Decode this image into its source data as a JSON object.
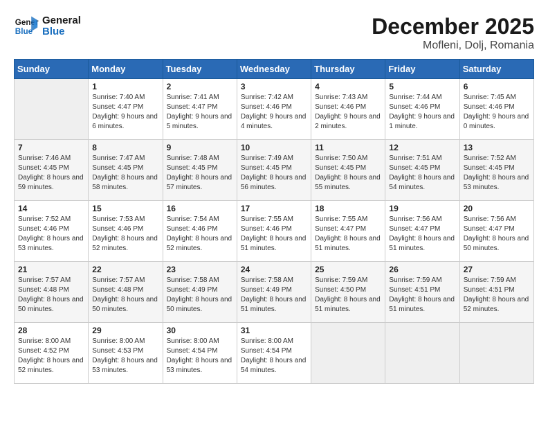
{
  "header": {
    "logo_line1": "General",
    "logo_line2": "Blue",
    "month": "December 2025",
    "location": "Mofleni, Dolj, Romania"
  },
  "weekdays": [
    "Sunday",
    "Monday",
    "Tuesday",
    "Wednesday",
    "Thursday",
    "Friday",
    "Saturday"
  ],
  "weeks": [
    [
      {
        "day": "",
        "empty": true
      },
      {
        "day": "1",
        "sunrise": "7:40 AM",
        "sunset": "4:47 PM",
        "daylight": "9 hours and 6 minutes."
      },
      {
        "day": "2",
        "sunrise": "7:41 AM",
        "sunset": "4:47 PM",
        "daylight": "9 hours and 5 minutes."
      },
      {
        "day": "3",
        "sunrise": "7:42 AM",
        "sunset": "4:46 PM",
        "daylight": "9 hours and 4 minutes."
      },
      {
        "day": "4",
        "sunrise": "7:43 AM",
        "sunset": "4:46 PM",
        "daylight": "9 hours and 2 minutes."
      },
      {
        "day": "5",
        "sunrise": "7:44 AM",
        "sunset": "4:46 PM",
        "daylight": "9 hours and 1 minute."
      },
      {
        "day": "6",
        "sunrise": "7:45 AM",
        "sunset": "4:46 PM",
        "daylight": "9 hours and 0 minutes."
      }
    ],
    [
      {
        "day": "7",
        "sunrise": "7:46 AM",
        "sunset": "4:45 PM",
        "daylight": "8 hours and 59 minutes."
      },
      {
        "day": "8",
        "sunrise": "7:47 AM",
        "sunset": "4:45 PM",
        "daylight": "8 hours and 58 minutes."
      },
      {
        "day": "9",
        "sunrise": "7:48 AM",
        "sunset": "4:45 PM",
        "daylight": "8 hours and 57 minutes."
      },
      {
        "day": "10",
        "sunrise": "7:49 AM",
        "sunset": "4:45 PM",
        "daylight": "8 hours and 56 minutes."
      },
      {
        "day": "11",
        "sunrise": "7:50 AM",
        "sunset": "4:45 PM",
        "daylight": "8 hours and 55 minutes."
      },
      {
        "day": "12",
        "sunrise": "7:51 AM",
        "sunset": "4:45 PM",
        "daylight": "8 hours and 54 minutes."
      },
      {
        "day": "13",
        "sunrise": "7:52 AM",
        "sunset": "4:45 PM",
        "daylight": "8 hours and 53 minutes."
      }
    ],
    [
      {
        "day": "14",
        "sunrise": "7:52 AM",
        "sunset": "4:46 PM",
        "daylight": "8 hours and 53 minutes."
      },
      {
        "day": "15",
        "sunrise": "7:53 AM",
        "sunset": "4:46 PM",
        "daylight": "8 hours and 52 minutes."
      },
      {
        "day": "16",
        "sunrise": "7:54 AM",
        "sunset": "4:46 PM",
        "daylight": "8 hours and 52 minutes."
      },
      {
        "day": "17",
        "sunrise": "7:55 AM",
        "sunset": "4:46 PM",
        "daylight": "8 hours and 51 minutes."
      },
      {
        "day": "18",
        "sunrise": "7:55 AM",
        "sunset": "4:47 PM",
        "daylight": "8 hours and 51 minutes."
      },
      {
        "day": "19",
        "sunrise": "7:56 AM",
        "sunset": "4:47 PM",
        "daylight": "8 hours and 51 minutes."
      },
      {
        "day": "20",
        "sunrise": "7:56 AM",
        "sunset": "4:47 PM",
        "daylight": "8 hours and 50 minutes."
      }
    ],
    [
      {
        "day": "21",
        "sunrise": "7:57 AM",
        "sunset": "4:48 PM",
        "daylight": "8 hours and 50 minutes."
      },
      {
        "day": "22",
        "sunrise": "7:57 AM",
        "sunset": "4:48 PM",
        "daylight": "8 hours and 50 minutes."
      },
      {
        "day": "23",
        "sunrise": "7:58 AM",
        "sunset": "4:49 PM",
        "daylight": "8 hours and 50 minutes."
      },
      {
        "day": "24",
        "sunrise": "7:58 AM",
        "sunset": "4:49 PM",
        "daylight": "8 hours and 51 minutes."
      },
      {
        "day": "25",
        "sunrise": "7:59 AM",
        "sunset": "4:50 PM",
        "daylight": "8 hours and 51 minutes."
      },
      {
        "day": "26",
        "sunrise": "7:59 AM",
        "sunset": "4:51 PM",
        "daylight": "8 hours and 51 minutes."
      },
      {
        "day": "27",
        "sunrise": "7:59 AM",
        "sunset": "4:51 PM",
        "daylight": "8 hours and 52 minutes."
      }
    ],
    [
      {
        "day": "28",
        "sunrise": "8:00 AM",
        "sunset": "4:52 PM",
        "daylight": "8 hours and 52 minutes."
      },
      {
        "day": "29",
        "sunrise": "8:00 AM",
        "sunset": "4:53 PM",
        "daylight": "8 hours and 53 minutes."
      },
      {
        "day": "30",
        "sunrise": "8:00 AM",
        "sunset": "4:54 PM",
        "daylight": "8 hours and 53 minutes."
      },
      {
        "day": "31",
        "sunrise": "8:00 AM",
        "sunset": "4:54 PM",
        "daylight": "8 hours and 54 minutes."
      },
      {
        "day": "",
        "empty": true
      },
      {
        "day": "",
        "empty": true
      },
      {
        "day": "",
        "empty": true
      }
    ]
  ]
}
